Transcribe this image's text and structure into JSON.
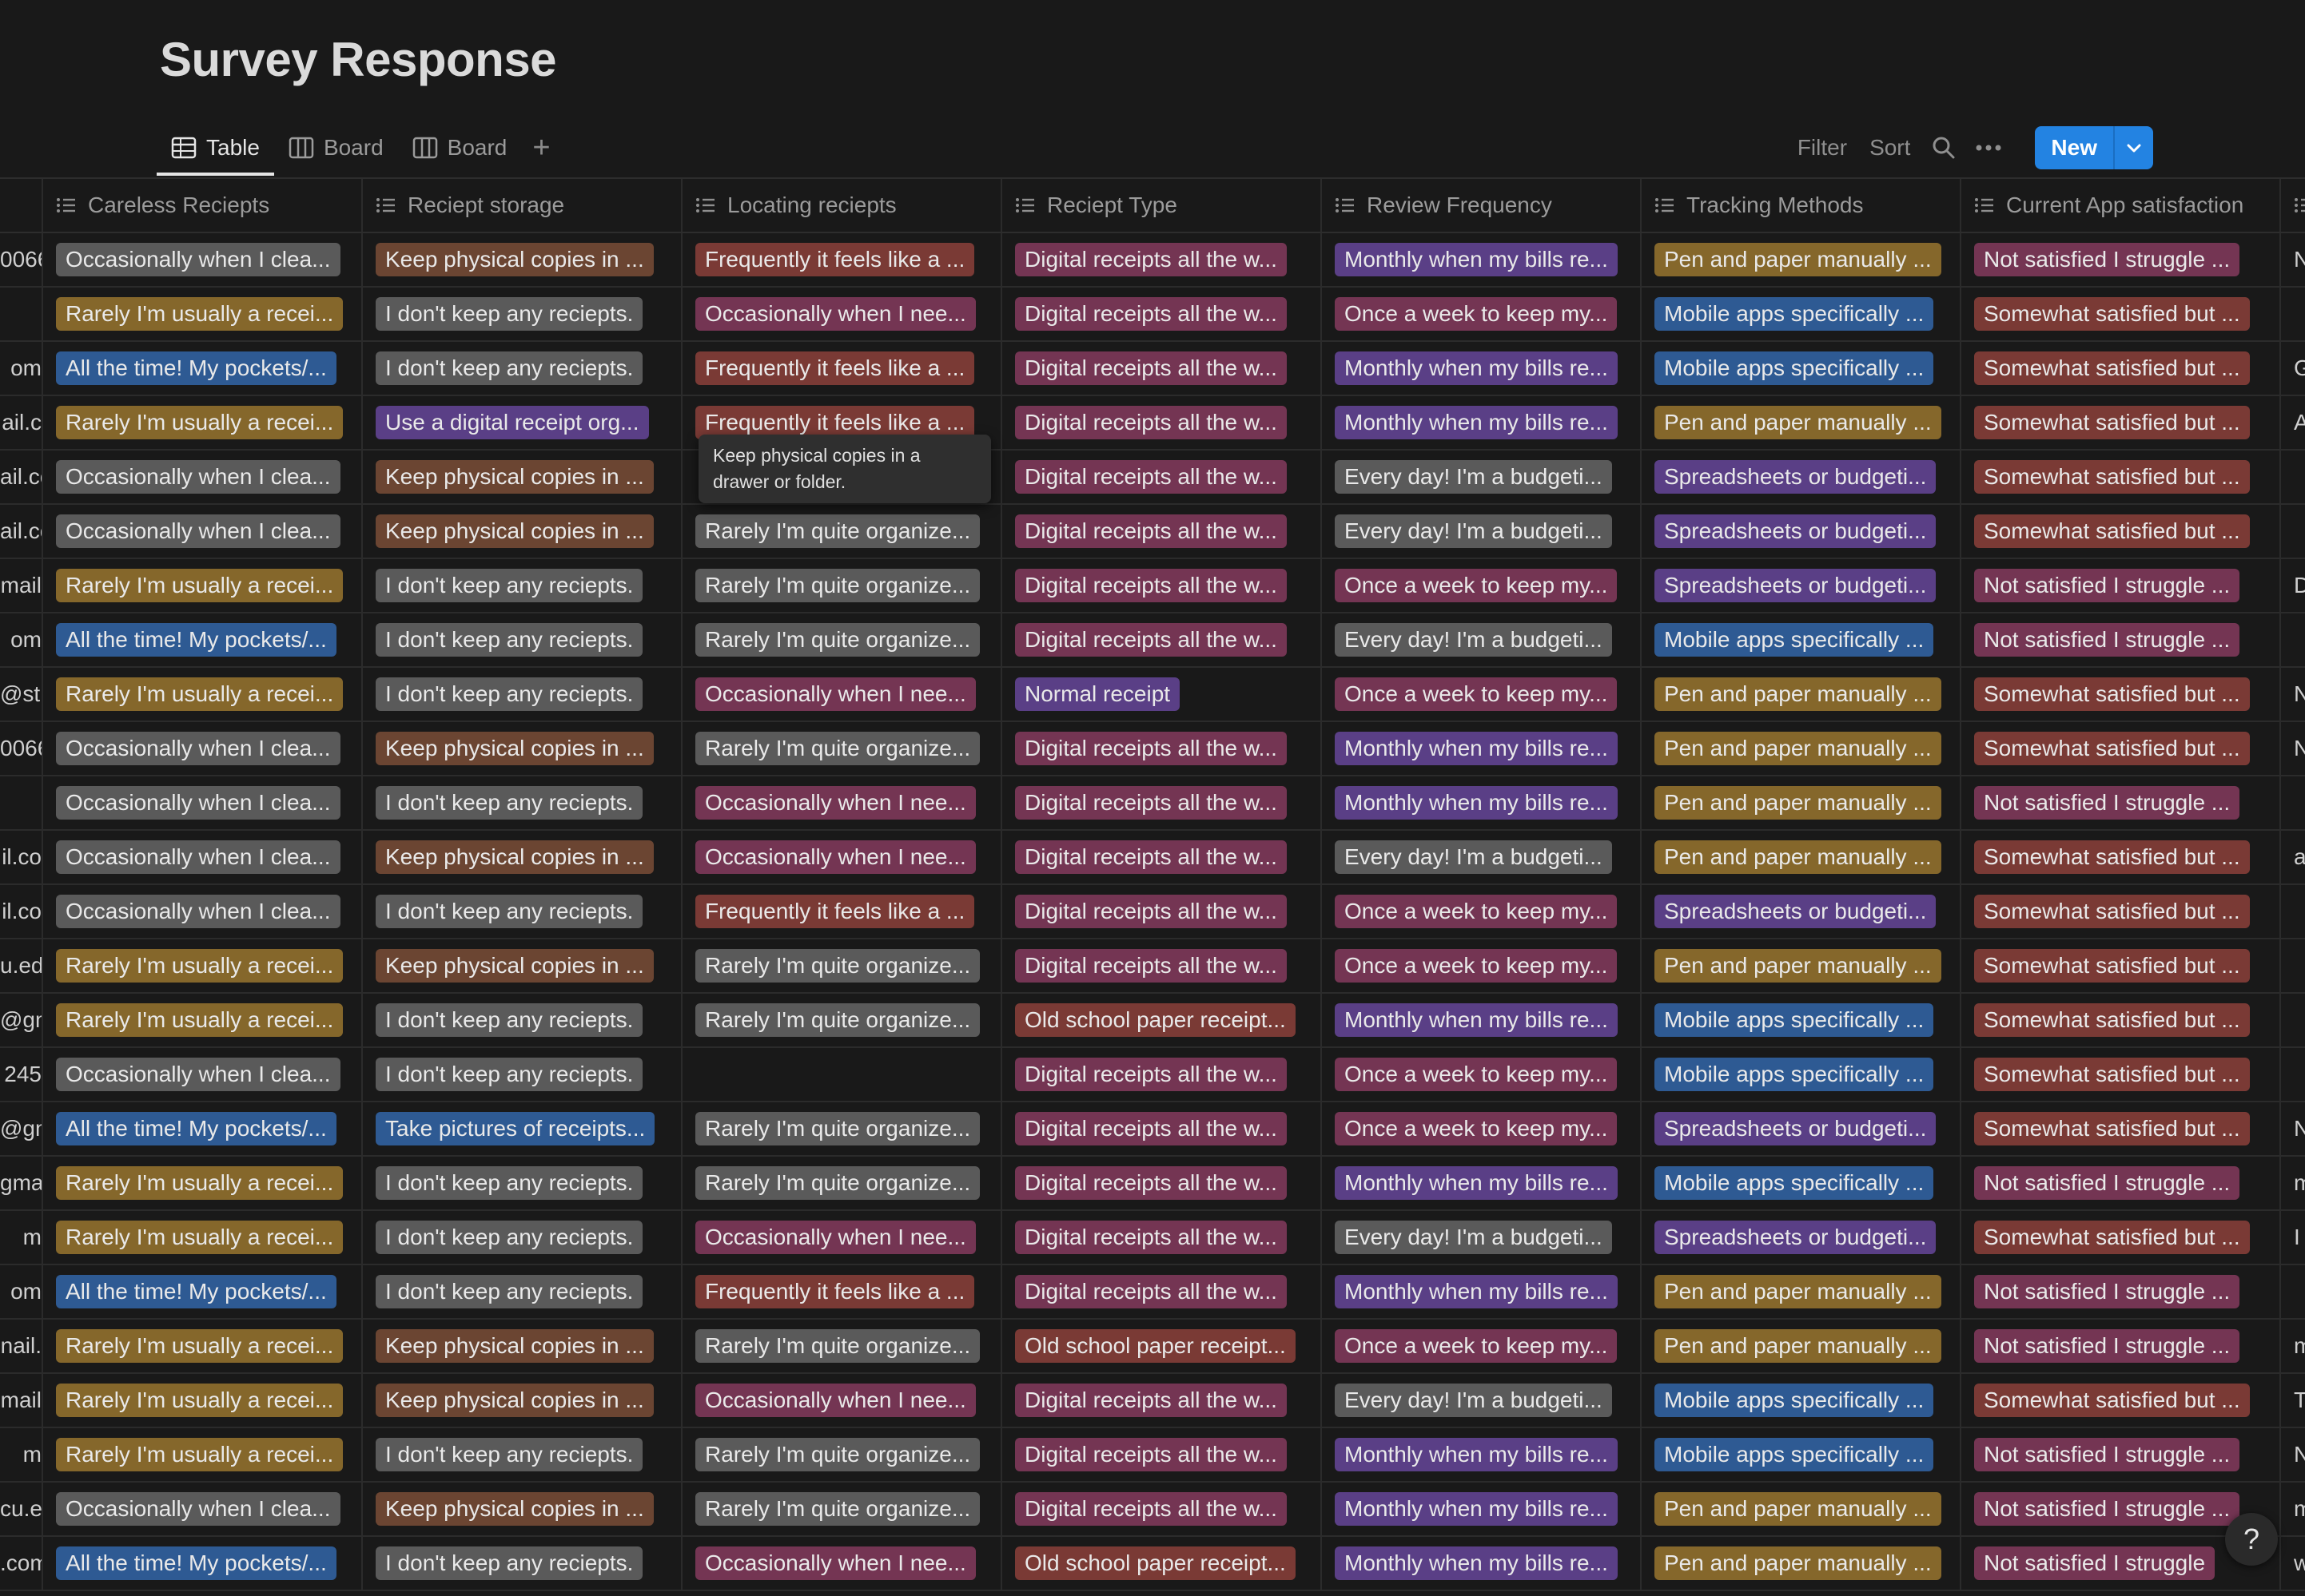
{
  "page": {
    "title": "Survey Response"
  },
  "views": [
    {
      "label": "Table",
      "icon": "table-icon",
      "active": true
    },
    {
      "label": "Board",
      "icon": "board-icon",
      "active": false
    },
    {
      "label": "Board",
      "icon": "board-icon",
      "active": false
    }
  ],
  "toolbar": {
    "filter": "Filter",
    "sort": "Sort",
    "new": "New"
  },
  "columns": [
    "Careless Reciepts",
    "Reciept storage",
    "Locating reciepts",
    "Reciept Type",
    "Review Frequency",
    "Tracking Methods",
    "Current App satisfaction"
  ],
  "colors": {
    "gray": "#5a5a5a",
    "orange": "#8a5a22",
    "brown": "#6b4532",
    "red": "#7a3a35",
    "pink": "#743553",
    "purple": "#5a3f86",
    "blue": "#2e5a93",
    "yellow": "#85672b",
    "accent": "#2383e2",
    "background": "#191919"
  },
  "tooltip": "Keep physical copies in a drawer or folder.",
  "help": "?",
  "rows": [
    {
      "email": "0066",
      "extra": "N",
      "cells": [
        [
          "Occasionally when I clea...",
          "gray"
        ],
        [
          "Keep physical copies in ...",
          "brown"
        ],
        [
          "Frequently it feels like a ...",
          "red"
        ],
        [
          "Digital receipts all the w...",
          "pink"
        ],
        [
          "Monthly when my bills re...",
          "purple"
        ],
        [
          "Pen and paper manually ...",
          "yellow"
        ],
        [
          "Not satisfied I struggle ...",
          "pink"
        ]
      ]
    },
    {
      "email": "",
      "extra": "",
      "cells": [
        [
          "Rarely I'm usually a recei...",
          "yellow"
        ],
        [
          "I don't keep any reciepts.",
          "gray"
        ],
        [
          "Occasionally when I nee...",
          "pink"
        ],
        [
          "Digital receipts all the w...",
          "pink"
        ],
        [
          "Once a week to keep my...",
          "pink"
        ],
        [
          "Mobile apps specifically ...",
          "blue"
        ],
        [
          "Somewhat satisfied but ...",
          "red"
        ]
      ]
    },
    {
      "email": "om",
      "extra": "G",
      "cells": [
        [
          "All the time! My pockets/...",
          "blue"
        ],
        [
          "I don't keep any reciepts.",
          "gray"
        ],
        [
          "Frequently it feels like a ...",
          "red"
        ],
        [
          "Digital receipts all the w...",
          "pink"
        ],
        [
          "Monthly when my bills re...",
          "purple"
        ],
        [
          "Mobile apps specifically ...",
          "blue"
        ],
        [
          "Somewhat satisfied but ...",
          "red"
        ]
      ]
    },
    {
      "email": "ail.c",
      "extra": "A",
      "cells": [
        [
          "Rarely I'm usually a recei...",
          "yellow"
        ],
        [
          "Use a digital receipt org...",
          "purple"
        ],
        [
          "Frequently it feels like a ...",
          "red"
        ],
        [
          "Digital receipts all the w...",
          "pink"
        ],
        [
          "Monthly when my bills re...",
          "purple"
        ],
        [
          "Pen and paper manually ...",
          "yellow"
        ],
        [
          "Somewhat satisfied but ...",
          "red"
        ]
      ]
    },
    {
      "email": "ail.co",
      "extra": "",
      "cells": [
        [
          "Occasionally when I clea...",
          "gray"
        ],
        [
          "Keep physical copies in ...",
          "brown"
        ],
        [
          "",
          ""
        ],
        [
          "Digital receipts all the w...",
          "pink"
        ],
        [
          "Every day! I'm a budgeti...",
          "gray"
        ],
        [
          "Spreadsheets or budgeti...",
          "purple"
        ],
        [
          "Somewhat satisfied but ...",
          "red"
        ]
      ]
    },
    {
      "email": "ail.co",
      "extra": "",
      "cells": [
        [
          "Occasionally when I clea...",
          "gray"
        ],
        [
          "Keep physical copies in ...",
          "brown"
        ],
        [
          "Rarely I'm quite organize...",
          "gray"
        ],
        [
          "Digital receipts all the w...",
          "pink"
        ],
        [
          "Every day! I'm a budgeti...",
          "gray"
        ],
        [
          "Spreadsheets or budgeti...",
          "purple"
        ],
        [
          "Somewhat satisfied but ...",
          "red"
        ]
      ]
    },
    {
      "email": "mail",
      "extra": "D",
      "cells": [
        [
          "Rarely I'm usually a recei...",
          "yellow"
        ],
        [
          "I don't keep any reciepts.",
          "gray"
        ],
        [
          "Rarely I'm quite organize...",
          "gray"
        ],
        [
          "Digital receipts all the w...",
          "pink"
        ],
        [
          "Once a week to keep my...",
          "pink"
        ],
        [
          "Spreadsheets or budgeti...",
          "purple"
        ],
        [
          "Not satisfied I struggle ...",
          "pink"
        ]
      ]
    },
    {
      "email": "om",
      "extra": "",
      "cells": [
        [
          "All the time! My pockets/...",
          "blue"
        ],
        [
          "I don't keep any reciepts.",
          "gray"
        ],
        [
          "Rarely I'm quite organize...",
          "gray"
        ],
        [
          "Digital receipts all the w...",
          "pink"
        ],
        [
          "Every day! I'm a budgeti...",
          "gray"
        ],
        [
          "Mobile apps specifically ...",
          "blue"
        ],
        [
          "Not satisfied I struggle ...",
          "pink"
        ]
      ]
    },
    {
      "email": "@stu",
      "extra": "N",
      "cells": [
        [
          "Rarely I'm usually a recei...",
          "yellow"
        ],
        [
          "I don't keep any reciepts.",
          "gray"
        ],
        [
          "Occasionally when I nee...",
          "pink"
        ],
        [
          "Normal receipt",
          "purple"
        ],
        [
          "Once a week to keep my...",
          "pink"
        ],
        [
          "Pen and paper manually ...",
          "yellow"
        ],
        [
          "Somewhat satisfied but ...",
          "red"
        ]
      ]
    },
    {
      "email": "0066",
      "extra": "N",
      "cells": [
        [
          "Occasionally when I clea...",
          "gray"
        ],
        [
          "Keep physical copies in ...",
          "brown"
        ],
        [
          "Rarely I'm quite organize...",
          "gray"
        ],
        [
          "Digital receipts all the w...",
          "pink"
        ],
        [
          "Monthly when my bills re...",
          "purple"
        ],
        [
          "Pen and paper manually ...",
          "yellow"
        ],
        [
          "Somewhat satisfied but ...",
          "red"
        ]
      ]
    },
    {
      "email": "",
      "extra": "",
      "cells": [
        [
          "Occasionally when I clea...",
          "gray"
        ],
        [
          "I don't keep any reciepts.",
          "gray"
        ],
        [
          "Occasionally when I nee...",
          "pink"
        ],
        [
          "Digital receipts all the w...",
          "pink"
        ],
        [
          "Monthly when my bills re...",
          "purple"
        ],
        [
          "Pen and paper manually ...",
          "yellow"
        ],
        [
          "Not satisfied I struggle ...",
          "pink"
        ]
      ]
    },
    {
      "email": "il.co",
      "extra": "a",
      "cells": [
        [
          "Occasionally when I clea...",
          "gray"
        ],
        [
          "Keep physical copies in ...",
          "brown"
        ],
        [
          "Occasionally when I nee...",
          "pink"
        ],
        [
          "Digital receipts all the w...",
          "pink"
        ],
        [
          "Every day! I'm a budgeti...",
          "gray"
        ],
        [
          "Pen and paper manually ...",
          "yellow"
        ],
        [
          "Somewhat satisfied but ...",
          "red"
        ]
      ]
    },
    {
      "email": "il.co",
      "extra": "",
      "cells": [
        [
          "Occasionally when I clea...",
          "gray"
        ],
        [
          "I don't keep any reciepts.",
          "gray"
        ],
        [
          "Frequently it feels like a ...",
          "red"
        ],
        [
          "Digital receipts all the w...",
          "pink"
        ],
        [
          "Once a week to keep my...",
          "pink"
        ],
        [
          "Spreadsheets or budgeti...",
          "purple"
        ],
        [
          "Somewhat satisfied but ...",
          "red"
        ]
      ]
    },
    {
      "email": "u.ed",
      "extra": "",
      "cells": [
        [
          "Rarely I'm usually a recei...",
          "yellow"
        ],
        [
          "Keep physical copies in ...",
          "brown"
        ],
        [
          "Rarely I'm quite organize...",
          "gray"
        ],
        [
          "Digital receipts all the w...",
          "pink"
        ],
        [
          "Once a week to keep my...",
          "pink"
        ],
        [
          "Pen and paper manually ...",
          "yellow"
        ],
        [
          "Somewhat satisfied but ...",
          "red"
        ]
      ]
    },
    {
      "email": "@gm",
      "extra": "",
      "cells": [
        [
          "Rarely I'm usually a recei...",
          "yellow"
        ],
        [
          "I don't keep any reciepts.",
          "gray"
        ],
        [
          "Rarely I'm quite organize...",
          "gray"
        ],
        [
          "Old school paper receipt...",
          "red"
        ],
        [
          "Monthly when my bills re...",
          "purple"
        ],
        [
          "Mobile apps specifically ...",
          "blue"
        ],
        [
          "Somewhat satisfied but ...",
          "red"
        ]
      ]
    },
    {
      "email": "245",
      "extra": "",
      "cells": [
        [
          "Occasionally when I clea...",
          "gray"
        ],
        [
          "I don't keep any reciepts.",
          "gray"
        ],
        [
          "",
          ""
        ],
        [
          "Digital receipts all the w...",
          "pink"
        ],
        [
          "Once a week to keep my...",
          "pink"
        ],
        [
          "Mobile apps specifically ...",
          "blue"
        ],
        [
          "Somewhat satisfied but ...",
          "red"
        ]
      ]
    },
    {
      "email": "@gm",
      "extra": "N",
      "cells": [
        [
          "All the time! My pockets/...",
          "blue"
        ],
        [
          "Take pictures of receipts...",
          "blue"
        ],
        [
          "Rarely I'm quite organize...",
          "gray"
        ],
        [
          "Digital receipts all the w...",
          "pink"
        ],
        [
          "Once a week to keep my...",
          "pink"
        ],
        [
          "Spreadsheets or budgeti...",
          "purple"
        ],
        [
          "Somewhat satisfied but ...",
          "red"
        ]
      ]
    },
    {
      "email": "gmai",
      "extra": "m",
      "cells": [
        [
          "Rarely I'm usually a recei...",
          "yellow"
        ],
        [
          "I don't keep any reciepts.",
          "gray"
        ],
        [
          "Rarely I'm quite organize...",
          "gray"
        ],
        [
          "Digital receipts all the w...",
          "pink"
        ],
        [
          "Monthly when my bills re...",
          "purple"
        ],
        [
          "Mobile apps specifically ...",
          "blue"
        ],
        [
          "Not satisfied I struggle ...",
          "pink"
        ]
      ]
    },
    {
      "email": "m",
      "extra": "I",
      "cells": [
        [
          "Rarely I'm usually a recei...",
          "yellow"
        ],
        [
          "I don't keep any reciepts.",
          "gray"
        ],
        [
          "Occasionally when I nee...",
          "pink"
        ],
        [
          "Digital receipts all the w...",
          "pink"
        ],
        [
          "Every day! I'm a budgeti...",
          "gray"
        ],
        [
          "Spreadsheets or budgeti...",
          "purple"
        ],
        [
          "Somewhat satisfied but ...",
          "red"
        ]
      ]
    },
    {
      "email": "om",
      "extra": "",
      "cells": [
        [
          "All the time! My pockets/...",
          "blue"
        ],
        [
          "I don't keep any reciepts.",
          "gray"
        ],
        [
          "Frequently it feels like a ...",
          "red"
        ],
        [
          "Digital receipts all the w...",
          "pink"
        ],
        [
          "Monthly when my bills re...",
          "purple"
        ],
        [
          "Pen and paper manually ...",
          "yellow"
        ],
        [
          "Not satisfied I struggle ...",
          "pink"
        ]
      ]
    },
    {
      "email": "nail.",
      "extra": "m",
      "cells": [
        [
          "Rarely I'm usually a recei...",
          "yellow"
        ],
        [
          "Keep physical copies in ...",
          "brown"
        ],
        [
          "Rarely I'm quite organize...",
          "gray"
        ],
        [
          "Old school paper receipt...",
          "red"
        ],
        [
          "Once a week to keep my...",
          "pink"
        ],
        [
          "Pen and paper manually ...",
          "yellow"
        ],
        [
          "Not satisfied I struggle ...",
          "pink"
        ]
      ]
    },
    {
      "email": "mail",
      "extra": "T",
      "cells": [
        [
          "Rarely I'm usually a recei...",
          "yellow"
        ],
        [
          "Keep physical copies in ...",
          "brown"
        ],
        [
          "Occasionally when I nee...",
          "pink"
        ],
        [
          "Digital receipts all the w...",
          "pink"
        ],
        [
          "Every day! I'm a budgeti...",
          "gray"
        ],
        [
          "Mobile apps specifically ...",
          "blue"
        ],
        [
          "Somewhat satisfied but ...",
          "red"
        ]
      ]
    },
    {
      "email": "m",
      "extra": "N",
      "cells": [
        [
          "Rarely I'm usually a recei...",
          "yellow"
        ],
        [
          "I don't keep any reciepts.",
          "gray"
        ],
        [
          "Rarely I'm quite organize...",
          "gray"
        ],
        [
          "Digital receipts all the w...",
          "pink"
        ],
        [
          "Monthly when my bills re...",
          "purple"
        ],
        [
          "Mobile apps specifically ...",
          "blue"
        ],
        [
          "Not satisfied I struggle ...",
          "pink"
        ]
      ]
    },
    {
      "email": "cu.e",
      "extra": "m",
      "cells": [
        [
          "Occasionally when I clea...",
          "gray"
        ],
        [
          "Keep physical copies in ...",
          "brown"
        ],
        [
          "Rarely I'm quite organize...",
          "gray"
        ],
        [
          "Digital receipts all the w...",
          "pink"
        ],
        [
          "Monthly when my bills re...",
          "purple"
        ],
        [
          "Pen and paper manually ...",
          "yellow"
        ],
        [
          "Not satisfied I struggle ...",
          "pink"
        ]
      ]
    },
    {
      "email": ".com",
      "extra": "w",
      "cells": [
        [
          "All the time! My pockets/...",
          "blue"
        ],
        [
          "I don't keep any reciepts.",
          "gray"
        ],
        [
          "Occasionally when I nee...",
          "pink"
        ],
        [
          "Old school paper receipt...",
          "red"
        ],
        [
          "Monthly when my bills re...",
          "purple"
        ],
        [
          "Pen and paper manually ...",
          "yellow"
        ],
        [
          "Not satisfied I struggle",
          "pink"
        ]
      ]
    }
  ]
}
